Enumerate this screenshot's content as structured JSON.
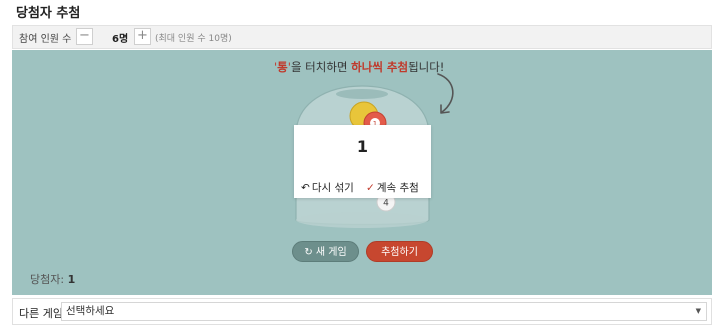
{
  "title": "당첨자 추첨",
  "participants": {
    "label": "참여 인원 수",
    "minus_label": "−",
    "count": "6명",
    "plus_label": "+",
    "max_info": "(최대 인원 수 10명)"
  },
  "hint": {
    "q_open": "'",
    "part1": "통",
    "q_close": "'",
    "part2": "을 터치하면 ",
    "part3": "하나씩 추첨",
    "part4": "됩니다!"
  },
  "result_card": {
    "number": "1",
    "reshuffle_label": "다시 섞기",
    "continue_label": "계속 추첨"
  },
  "ball_labels": [
    "1",
    "4"
  ],
  "buttons": {
    "new_game": "새 게임",
    "draw": "추첨하기"
  },
  "winners": {
    "label": "당첨자:",
    "value": "1"
  },
  "other_game": {
    "label": "다른 게임",
    "placeholder": "선택하세요"
  },
  "colors": {
    "stage_bg": "#9ec2c0",
    "accent_red": "#c7472f",
    "new_game_bg": "#6d8f8c",
    "ball_red": "#e35b4a",
    "ball_yellow": "#e8c53a"
  }
}
